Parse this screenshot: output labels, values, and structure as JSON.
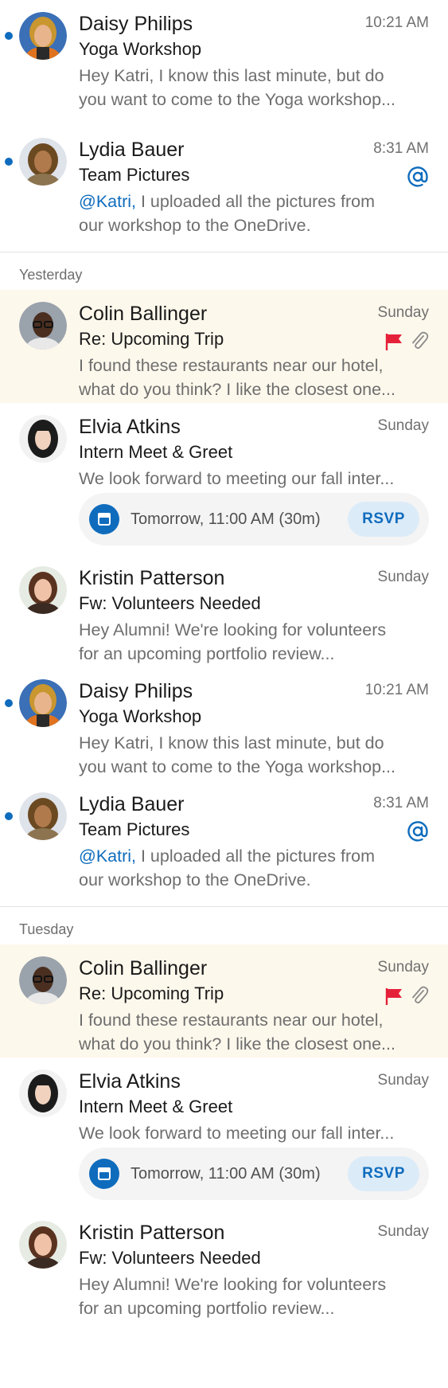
{
  "colors": {
    "accent": "#0f6cbd",
    "flag": "#e5213a",
    "flagged_background": "#fdf8ec"
  },
  "messages": [
    {
      "sender": "Daisy Philips",
      "time": "10:21 AM",
      "subject": "Yoga Workshop",
      "mention": "",
      "preview_line1": "Hey Katri, I know this last minute, but do",
      "preview_line2": "you want to come to the Yoga workshop...",
      "unread": true,
      "avatar_icon": "avatar-daisy"
    },
    {
      "sender": "Lydia Bauer",
      "time": "8:31 AM",
      "subject": "Team Pictures",
      "mention": "@Katri,",
      "preview_line1": " I uploaded all the pictures from",
      "preview_line2": "our workshop to the OneDrive.",
      "unread": true,
      "avatar_icon": "avatar-lydia",
      "status_icon": "at-mention-icon"
    }
  ],
  "section_yesterday": {
    "header": "Yesterday",
    "messages": [
      {
        "sender": "Colin Ballinger",
        "time": "Sunday",
        "subject": "Re: Upcoming Trip",
        "preview_line1": "I found these restaurants near our hotel,",
        "preview_line2": "what do you think? I like the closest one...",
        "flagged": true,
        "has_attachment": true,
        "avatar_icon": "avatar-colin"
      },
      {
        "sender": "Elvia Atkins",
        "time": "Sunday",
        "subject": "Intern Meet & Greet",
        "preview_line1": "We look forward to meeting our fall inter...",
        "event": "Tomorrow, 11:00 AM (30m)",
        "rsvp_label": "RSVP",
        "avatar_icon": "avatar-elvia"
      },
      {
        "sender": "Kristin Patterson",
        "time": "Sunday",
        "subject": "Fw: Volunteers Needed",
        "preview_line1": "Hey Alumni! We're looking for volunteers",
        "preview_line2": "for an upcoming portfolio review...",
        "avatar_icon": "avatar-kristin"
      },
      {
        "sender": "Daisy Philips",
        "time": "10:21 AM",
        "subject": "Yoga Workshop",
        "preview_line1": "Hey Katri, I know this last minute, but do",
        "preview_line2": "you want to come to the Yoga workshop...",
        "unread": true,
        "avatar_icon": "avatar-daisy"
      },
      {
        "sender": "Lydia Bauer",
        "time": "8:31 AM",
        "subject": "Team Pictures",
        "mention": "@Katri,",
        "preview_line1": " I uploaded all the pictures from",
        "preview_line2": "our workshop to the OneDrive.",
        "unread": true,
        "avatar_icon": "avatar-lydia",
        "status_icon": "at-mention-icon"
      }
    ]
  },
  "section_tuesday": {
    "header": "Tuesday",
    "messages": [
      {
        "sender": "Colin Ballinger",
        "time": "Sunday",
        "subject": "Re: Upcoming Trip",
        "preview_line1": "I found these restaurants near our hotel,",
        "preview_line2": "what do you think? I like the closest one...",
        "flagged": true,
        "has_attachment": true,
        "avatar_icon": "avatar-colin"
      },
      {
        "sender": "Elvia Atkins",
        "time": "Sunday",
        "subject": "Intern Meet & Greet",
        "preview_line1": "We look forward to meeting our fall inter...",
        "event": "Tomorrow, 11:00 AM (30m)",
        "rsvp_label": "RSVP",
        "avatar_icon": "avatar-elvia"
      },
      {
        "sender": "Kristin Patterson",
        "time": "Sunday",
        "subject": "Fw: Volunteers Needed",
        "preview_line1": "Hey Alumni! We're looking for volunteers",
        "preview_line2": "for an upcoming portfolio review...",
        "avatar_icon": "avatar-kristin"
      }
    ]
  }
}
